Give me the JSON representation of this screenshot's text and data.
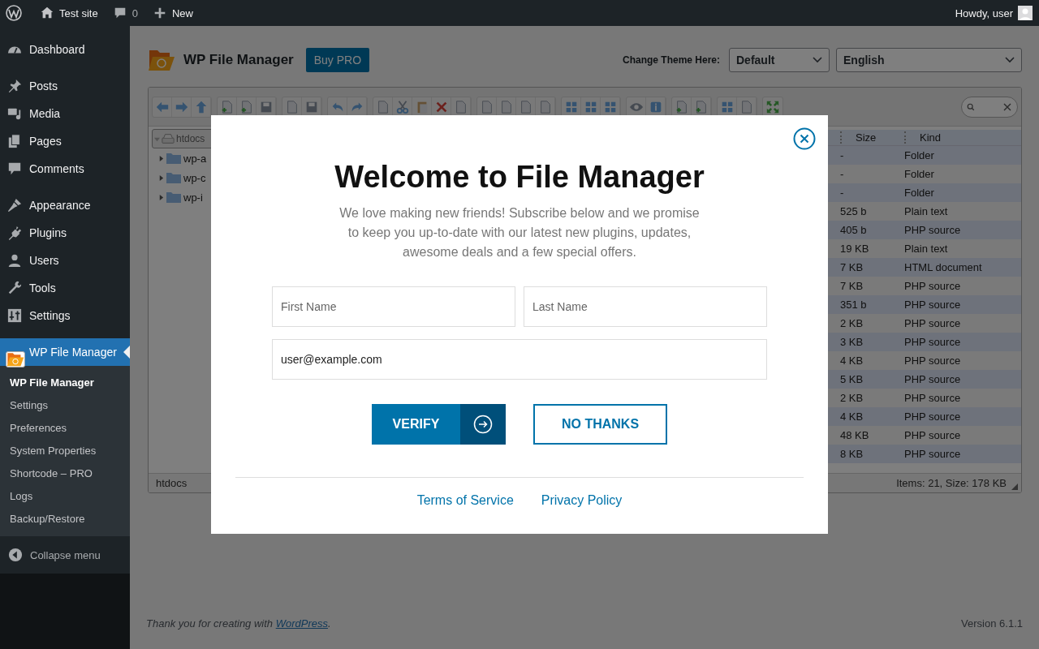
{
  "admin_bar": {
    "site": "Test site",
    "comments": "0",
    "new": "New",
    "greeting": "Howdy, user"
  },
  "sidebar": {
    "groups": [
      {
        "items": [
          {
            "label": "Dashboard",
            "selected": false
          }
        ]
      },
      {
        "items": [
          {
            "label": "Posts",
            "selected": false
          },
          {
            "label": "Media",
            "selected": false
          },
          {
            "label": "Pages",
            "selected": false
          },
          {
            "label": "Comments",
            "selected": false
          }
        ]
      },
      {
        "items": [
          {
            "label": "Appearance",
            "selected": false
          },
          {
            "label": "Plugins",
            "selected": false
          },
          {
            "label": "Users",
            "selected": false
          },
          {
            "label": "Tools",
            "selected": false
          },
          {
            "label": "Settings",
            "selected": false
          }
        ]
      },
      {
        "items": [
          {
            "label": "WP File Manager",
            "selected": true,
            "submenu": [
              {
                "label": "WP File Manager",
                "selected": true
              },
              {
                "label": "Settings",
                "selected": false
              },
              {
                "label": "Preferences",
                "selected": false
              },
              {
                "label": "System Properties",
                "selected": false
              },
              {
                "label": "Shortcode – PRO",
                "selected": false
              },
              {
                "label": "Logs",
                "selected": false
              },
              {
                "label": "Backup/Restore",
                "selected": false
              }
            ]
          }
        ]
      }
    ],
    "collapse": "Collapse menu"
  },
  "header": {
    "title": "WP File Manager",
    "buy_button": "Buy PRO",
    "theme_label": "Change Theme Here:",
    "theme_select": "Default",
    "language_select": "English"
  },
  "file_manager": {
    "tree": {
      "label": "htdocs",
      "expanded": true,
      "children": [
        {
          "label": "wp-a",
          "expanded": false
        },
        {
          "label": "wp-c",
          "expanded": false
        },
        {
          "label": "wp-i",
          "expanded": false
        }
      ]
    },
    "columns": [
      "Size",
      "Kind"
    ],
    "rows": [
      {
        "size": "-",
        "kind": "Folder"
      },
      {
        "size": "-",
        "kind": "Folder"
      },
      {
        "size": "-",
        "kind": "Folder"
      },
      {
        "size": "525 b",
        "kind": "Plain text"
      },
      {
        "size": "405 b",
        "kind": "PHP source"
      },
      {
        "size": "19 KB",
        "kind": "Plain text"
      },
      {
        "size": "7 KB",
        "kind": "HTML document"
      },
      {
        "size": "7 KB",
        "kind": "PHP source"
      },
      {
        "size": "351 b",
        "kind": "PHP source"
      },
      {
        "size": "2 KB",
        "kind": "PHP source"
      },
      {
        "size": "3 KB",
        "kind": "PHP source"
      },
      {
        "size": "4 KB",
        "kind": "PHP source"
      },
      {
        "size": "5 KB",
        "kind": "PHP source"
      },
      {
        "size": "2 KB",
        "kind": "PHP source"
      },
      {
        "size": "4 KB",
        "kind": "PHP source"
      },
      {
        "size": "48 KB",
        "kind": "PHP source"
      },
      {
        "size": "8 KB",
        "kind": "PHP source"
      }
    ],
    "status_path": "htdocs",
    "status_summary": "Items: 21, Size: 178 KB"
  },
  "modal": {
    "title": "Welcome to File Manager",
    "text": "We love making new friends! Subscribe below and we promise to keep you up-to-date with our latest new plugins, updates, awesome deals and a few special offers.",
    "fields": [
      {
        "placeholder": "First Name"
      },
      {
        "placeholder": "Last Name"
      },
      {
        "value": "user@example.com"
      }
    ],
    "verify": "VERIFY",
    "no_thanks": "NO THANKS",
    "links": [
      "Terms of Service",
      "Privacy Policy"
    ]
  },
  "footer": {
    "before": "Thank you for creating with ",
    "link": "WordPress",
    "after": ".",
    "version": "Version 6.1.1"
  }
}
